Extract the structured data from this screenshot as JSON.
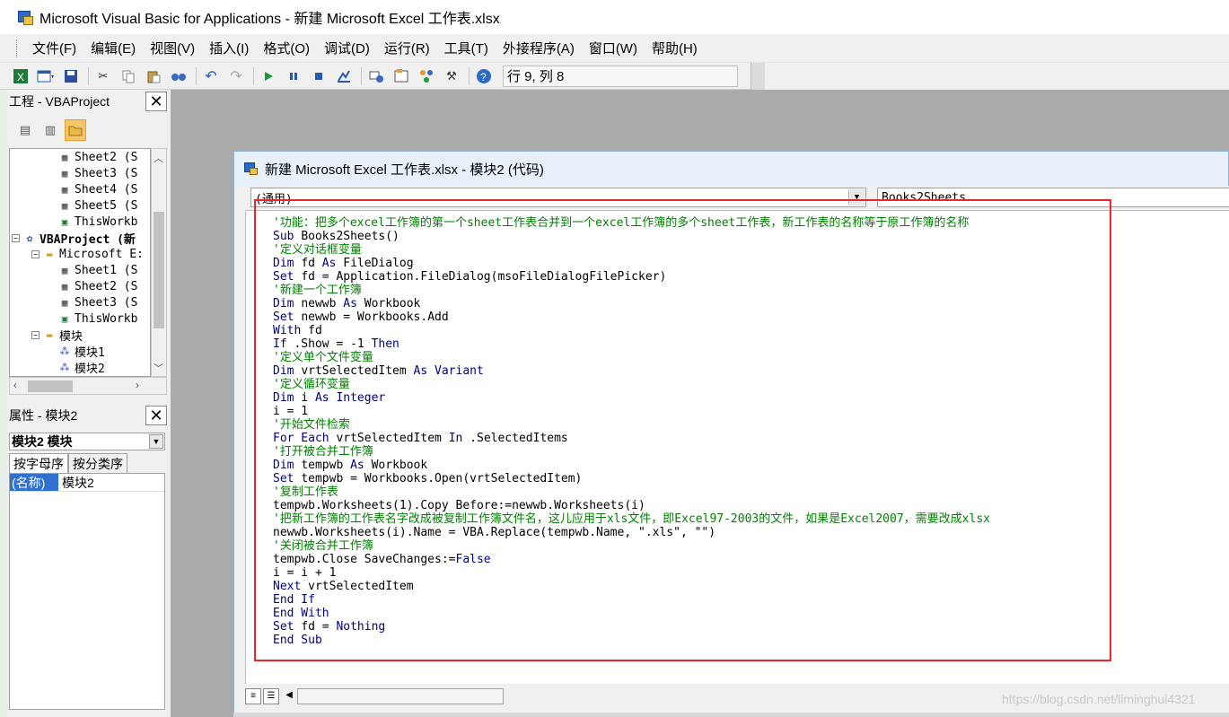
{
  "window": {
    "title": "Microsoft Visual Basic for Applications - 新建 Microsoft Excel 工作表.xlsx"
  },
  "menu": [
    "文件(F)",
    "编辑(E)",
    "视图(V)",
    "插入(I)",
    "格式(O)",
    "调试(D)",
    "运行(R)",
    "工具(T)",
    "外接程序(A)",
    "窗口(W)",
    "帮助(H)"
  ],
  "toolbar": {
    "icons": [
      "excel-icon",
      "insert-form-icon",
      "save-icon",
      "cut-icon",
      "copy-icon",
      "paste-icon",
      "find-icon",
      "undo-icon",
      "redo-icon",
      "run-icon",
      "break-icon",
      "reset-icon",
      "design-mode-icon",
      "project-explorer-icon",
      "properties-icon",
      "object-browser-icon",
      "toolbox-icon",
      "help-icon"
    ],
    "cursor_position": "行 9, 列 8"
  },
  "project_pane": {
    "title": "工程 - VBAProject",
    "tree": [
      {
        "label": "Sheet2 (S",
        "icon": "sheet-icon",
        "level": 3
      },
      {
        "label": "Sheet3 (S",
        "icon": "sheet-icon",
        "level": 3
      },
      {
        "label": "Sheet4 (S",
        "icon": "sheet-icon",
        "level": 3
      },
      {
        "label": "Sheet5 (S",
        "icon": "sheet-icon",
        "level": 3
      },
      {
        "label": "ThisWorkb",
        "icon": "workbook-icon",
        "level": 3
      },
      {
        "label": "VBAProject (新",
        "icon": "vbaproject-icon",
        "level": 1,
        "bold": true
      },
      {
        "label": "Microsoft E:",
        "icon": "folder-icon",
        "level": 2
      },
      {
        "label": "Sheet1 (S",
        "icon": "sheet-icon",
        "level": 3
      },
      {
        "label": "Sheet2 (S",
        "icon": "sheet-icon",
        "level": 3
      },
      {
        "label": "Sheet3 (S",
        "icon": "sheet-icon",
        "level": 3
      },
      {
        "label": "ThisWorkb",
        "icon": "workbook-icon",
        "level": 3
      },
      {
        "label": "模块",
        "icon": "folder-icon",
        "level": 2
      },
      {
        "label": "模块1",
        "icon": "module-icon",
        "level": 3
      },
      {
        "label": "模块2",
        "icon": "module-icon",
        "level": 3
      }
    ]
  },
  "properties_pane": {
    "title": "属性 - 模块2",
    "object_select": "模块2 模块",
    "tabs": [
      "按字母序",
      "按分类序"
    ],
    "rows": [
      {
        "key": "(名称)",
        "value": "模块2"
      }
    ]
  },
  "code_window": {
    "title": "新建 Microsoft Excel 工作表.xlsx - 模块2 (代码)",
    "object_combo": "(通用)",
    "procedure_combo": "Books2Sheets",
    "lines": [
      [
        {
          "t": "'功能：把多个excel工作簿的第一个sheet工作表合并到一个excel工作簿的多个sheet工作表，新工作表的名称等于原工作簿的名称",
          "c": "cmt"
        }
      ],
      [
        {
          "t": "Sub ",
          "c": "kw"
        },
        {
          "t": "Books2Sheets()",
          "c": "txt"
        }
      ],
      [
        {
          "t": "'定义对话框变量",
          "c": "cmt"
        }
      ],
      [
        {
          "t": "Dim ",
          "c": "kw"
        },
        {
          "t": "fd ",
          "c": "txt"
        },
        {
          "t": "As ",
          "c": "kw"
        },
        {
          "t": "FileDialog",
          "c": "txt"
        }
      ],
      [
        {
          "t": "Set ",
          "c": "kw"
        },
        {
          "t": "fd = Application.FileDialog(msoFileDialogFilePicker)",
          "c": "txt"
        }
      ],
      [
        {
          "t": "'新建一个工作簿",
          "c": "cmt"
        }
      ],
      [
        {
          "t": "Dim ",
          "c": "kw"
        },
        {
          "t": "newwb ",
          "c": "txt"
        },
        {
          "t": "As ",
          "c": "kw"
        },
        {
          "t": "Workbook",
          "c": "txt"
        }
      ],
      [
        {
          "t": "Set ",
          "c": "kw"
        },
        {
          "t": "newwb = Workbooks.Add",
          "c": "txt"
        }
      ],
      [
        {
          "t": "With ",
          "c": "kw"
        },
        {
          "t": "fd",
          "c": "txt"
        }
      ],
      [
        {
          "t": "If ",
          "c": "kw"
        },
        {
          "t": ".Show = -1 ",
          "c": "txt"
        },
        {
          "t": "Then",
          "c": "kw"
        }
      ],
      [
        {
          "t": "'定义单个文件变量",
          "c": "cmt"
        }
      ],
      [
        {
          "t": "Dim ",
          "c": "kw"
        },
        {
          "t": "vrtSelectedItem ",
          "c": "txt"
        },
        {
          "t": "As Variant",
          "c": "kw"
        }
      ],
      [
        {
          "t": "'定义循环变量",
          "c": "cmt"
        }
      ],
      [
        {
          "t": "Dim ",
          "c": "kw"
        },
        {
          "t": "i ",
          "c": "txt"
        },
        {
          "t": "As Integer",
          "c": "kw"
        }
      ],
      [
        {
          "t": "i = 1",
          "c": "txt"
        }
      ],
      [
        {
          "t": "'开始文件检索",
          "c": "cmt"
        }
      ],
      [
        {
          "t": "For Each ",
          "c": "kw"
        },
        {
          "t": "vrtSelectedItem ",
          "c": "txt"
        },
        {
          "t": "In ",
          "c": "kw"
        },
        {
          "t": ".SelectedItems",
          "c": "txt"
        }
      ],
      [
        {
          "t": "'打开被合并工作簿",
          "c": "cmt"
        }
      ],
      [
        {
          "t": "Dim ",
          "c": "kw"
        },
        {
          "t": "tempwb ",
          "c": "txt"
        },
        {
          "t": "As ",
          "c": "kw"
        },
        {
          "t": "Workbook",
          "c": "txt"
        }
      ],
      [
        {
          "t": "Set ",
          "c": "kw"
        },
        {
          "t": "tempwb = Workbooks.Open(vrtSelectedItem)",
          "c": "txt"
        }
      ],
      [
        {
          "t": "'复制工作表",
          "c": "cmt"
        }
      ],
      [
        {
          "t": "tempwb.Worksheets(1).Copy Before:=newwb.Worksheets(i)",
          "c": "txt"
        }
      ],
      [
        {
          "t": "'把新工作簿的工作表名字改成被复制工作簿文件名，这儿应用于xls文件，即Excel97-2003的文件，如果是Excel2007，需要改成xlsx",
          "c": "cmt"
        }
      ],
      [
        {
          "t": "newwb.Worksheets(i).Name = VBA.Replace(tempwb.Name, \".xls\", \"\")",
          "c": "txt"
        }
      ],
      [
        {
          "t": "'关闭被合并工作簿",
          "c": "cmt"
        }
      ],
      [
        {
          "t": "tempwb.Close SaveChanges:=",
          "c": "txt"
        },
        {
          "t": "False",
          "c": "kw"
        }
      ],
      [
        {
          "t": "i = i + 1",
          "c": "txt"
        }
      ],
      [
        {
          "t": "Next ",
          "c": "kw"
        },
        {
          "t": "vrtSelectedItem",
          "c": "txt"
        }
      ],
      [
        {
          "t": "End If",
          "c": "kw"
        }
      ],
      [
        {
          "t": "End With",
          "c": "kw"
        }
      ],
      [
        {
          "t": "Set ",
          "c": "kw"
        },
        {
          "t": "fd = ",
          "c": "txt"
        },
        {
          "t": "Nothing",
          "c": "kw"
        }
      ],
      [
        {
          "t": "End Sub",
          "c": "kw"
        }
      ]
    ]
  },
  "watermark": "https://blog.csdn.net/liminghui4321",
  "colors": {
    "comment": "#007f00",
    "keyword": "#00007f",
    "highlight_box": "#e8262b"
  }
}
